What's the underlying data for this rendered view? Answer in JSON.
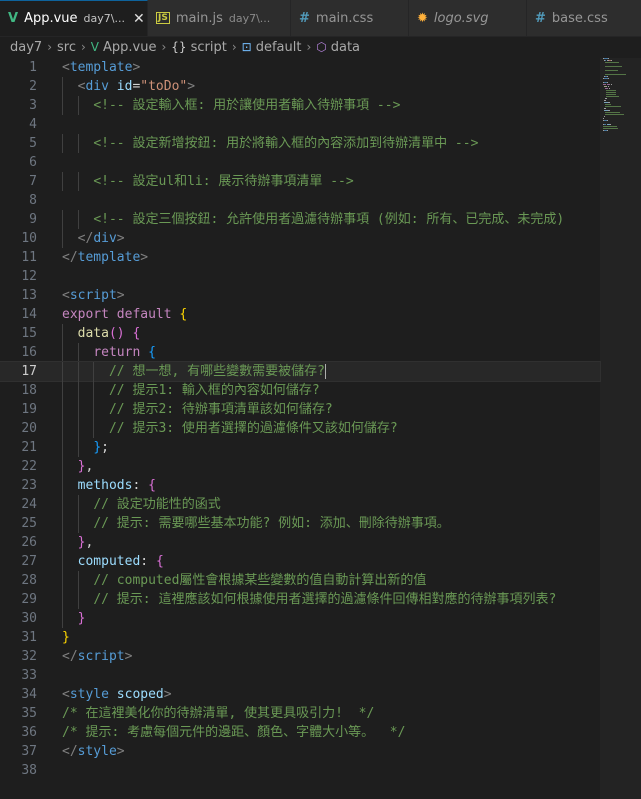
{
  "tabs": [
    {
      "icon": "V",
      "icon_color": "#41b883",
      "name": "App.vue",
      "desc": "day7\\...",
      "close": "✕",
      "active": true,
      "width": 148
    },
    {
      "icon": "JS",
      "icon_color": "#cbcb41",
      "name": "main.js",
      "desc": "day7\\...",
      "close": "",
      "active": false,
      "width": 143
    },
    {
      "icon": "#",
      "icon_color": "#519aba",
      "name": "main.css",
      "desc": "",
      "close": "",
      "active": false,
      "width": 118
    },
    {
      "icon": "✹",
      "icon_color": "#ffb13b",
      "name": "logo.svg",
      "desc": "",
      "close": "",
      "active": false,
      "width": 118,
      "italic": true
    },
    {
      "icon": "#",
      "icon_color": "#519aba",
      "name": "base.css",
      "desc": "",
      "close": "",
      "active": false,
      "width": 120
    }
  ],
  "breadcrumb": [
    {
      "label": "day7",
      "icon": "",
      "icon_color": ""
    },
    {
      "label": "src",
      "icon": "",
      "icon_color": ""
    },
    {
      "label": "App.vue",
      "icon": "V",
      "icon_color": "#41b883"
    },
    {
      "label": "script",
      "icon": "{}",
      "icon_color": "#cccccc"
    },
    {
      "label": "default",
      "icon": "⊡",
      "icon_color": "#75beff"
    },
    {
      "label": "data",
      "icon": "⬡",
      "icon_color": "#b180d7"
    }
  ],
  "editor": {
    "current_line": 17,
    "lines": [
      [
        [
          "tk-punc",
          "<"
        ],
        [
          "tk-tag",
          "template"
        ],
        [
          "tk-punc",
          ">"
        ]
      ],
      [
        [
          "tk-text",
          "  "
        ],
        [
          "tk-punc",
          "<"
        ],
        [
          "tk-tag",
          "div"
        ],
        [
          "tk-text",
          " "
        ],
        [
          "tk-attr",
          "id"
        ],
        [
          "tk-text",
          "="
        ],
        [
          "tk-str",
          "\"toDo\""
        ],
        [
          "tk-punc",
          ">"
        ]
      ],
      [
        [
          "tk-text",
          "    "
        ],
        [
          "tk-com",
          "<!-- 設定輸入框: 用於讓使用者輸入待辦事項 -->"
        ]
      ],
      [],
      [
        [
          "tk-text",
          "    "
        ],
        [
          "tk-com",
          "<!-- 設定新增按鈕: 用於將輸入框的內容添加到待辦清單中 -->"
        ]
      ],
      [],
      [
        [
          "tk-text",
          "    "
        ],
        [
          "tk-com",
          "<!-- 設定ul和li: 展示待辦事項清單 -->"
        ]
      ],
      [],
      [
        [
          "tk-text",
          "    "
        ],
        [
          "tk-com",
          "<!-- 設定三個按鈕: 允許使用者過濾待辦事項 (例如: 所有、已完成、未完成)"
        ]
      ],
      [
        [
          "tk-text",
          "  "
        ],
        [
          "tk-punc",
          "</"
        ],
        [
          "tk-tag",
          "div"
        ],
        [
          "tk-punc",
          ">"
        ]
      ],
      [
        [
          "tk-punc",
          "</"
        ],
        [
          "tk-tag",
          "template"
        ],
        [
          "tk-punc",
          ">"
        ]
      ],
      [],
      [
        [
          "tk-punc",
          "<"
        ],
        [
          "tk-tag",
          "script"
        ],
        [
          "tk-punc",
          ">"
        ]
      ],
      [
        [
          "tk-kw",
          "export"
        ],
        [
          "tk-text",
          " "
        ],
        [
          "tk-kw",
          "default"
        ],
        [
          "tk-text",
          " "
        ],
        [
          "tk-b1",
          "{"
        ]
      ],
      [
        [
          "tk-text",
          "  "
        ],
        [
          "tk-fn",
          "data"
        ],
        [
          "tk-b2",
          "()"
        ],
        [
          "tk-text",
          " "
        ],
        [
          "tk-b2",
          "{"
        ]
      ],
      [
        [
          "tk-text",
          "    "
        ],
        [
          "tk-kw",
          "return"
        ],
        [
          "tk-text",
          " "
        ],
        [
          "tk-b3",
          "{"
        ]
      ],
      [
        [
          "tk-text",
          "      "
        ],
        [
          "tk-com",
          "// 想一想, 有哪些變數需要被儲存?"
        ],
        [
          "cursor",
          ""
        ]
      ],
      [
        [
          "tk-text",
          "      "
        ],
        [
          "tk-com",
          "// 提示1: 輸入框的內容如何儲存?"
        ]
      ],
      [
        [
          "tk-text",
          "      "
        ],
        [
          "tk-com",
          "// 提示2: 待辦事項清單該如何儲存?"
        ]
      ],
      [
        [
          "tk-text",
          "      "
        ],
        [
          "tk-com",
          "// 提示3: 使用者選擇的過濾條件又該如何儲存?"
        ]
      ],
      [
        [
          "tk-text",
          "    "
        ],
        [
          "tk-b3",
          "}"
        ],
        [
          "tk-text",
          ";"
        ]
      ],
      [
        [
          "tk-text",
          "  "
        ],
        [
          "tk-b2",
          "}"
        ],
        [
          "tk-text",
          ","
        ]
      ],
      [
        [
          "tk-text",
          "  "
        ],
        [
          "tk-prop",
          "methods"
        ],
        [
          "tk-text",
          ": "
        ],
        [
          "tk-b2",
          "{"
        ]
      ],
      [
        [
          "tk-text",
          "    "
        ],
        [
          "tk-com",
          "// 設定功能性的函式"
        ]
      ],
      [
        [
          "tk-text",
          "    "
        ],
        [
          "tk-com",
          "// 提示: 需要哪些基本功能? 例如: 添加、刪除待辦事項。"
        ]
      ],
      [
        [
          "tk-text",
          "  "
        ],
        [
          "tk-b2",
          "}"
        ],
        [
          "tk-text",
          ","
        ]
      ],
      [
        [
          "tk-text",
          "  "
        ],
        [
          "tk-prop",
          "computed"
        ],
        [
          "tk-text",
          ": "
        ],
        [
          "tk-b2",
          "{"
        ]
      ],
      [
        [
          "tk-text",
          "    "
        ],
        [
          "tk-com",
          "// computed屬性會根據某些變數的值自動計算出新的值"
        ]
      ],
      [
        [
          "tk-text",
          "    "
        ],
        [
          "tk-com",
          "// 提示: 這裡應該如何根據使用者選擇的過濾條件回傳相對應的待辦事項列表?"
        ]
      ],
      [
        [
          "tk-text",
          "  "
        ],
        [
          "tk-b2",
          "}"
        ]
      ],
      [
        [
          "tk-b1",
          "}"
        ]
      ],
      [
        [
          "tk-punc",
          "</"
        ],
        [
          "tk-tag",
          "script"
        ],
        [
          "tk-punc",
          ">"
        ]
      ],
      [],
      [
        [
          "tk-punc",
          "<"
        ],
        [
          "tk-tag",
          "style"
        ],
        [
          "tk-text",
          " "
        ],
        [
          "tk-attr",
          "scoped"
        ],
        [
          "tk-punc",
          ">"
        ]
      ],
      [
        [
          "tk-com",
          "/* 在這裡美化你的待辦清單, 使其更具吸引力!  */"
        ]
      ],
      [
        [
          "tk-com",
          "/* 提示: 考慮每個元件的邊距、顏色、字體大小等。  */"
        ]
      ],
      [
        [
          "tk-punc",
          "</"
        ],
        [
          "tk-tag",
          "style"
        ],
        [
          "tk-punc",
          ">"
        ]
      ],
      []
    ]
  }
}
